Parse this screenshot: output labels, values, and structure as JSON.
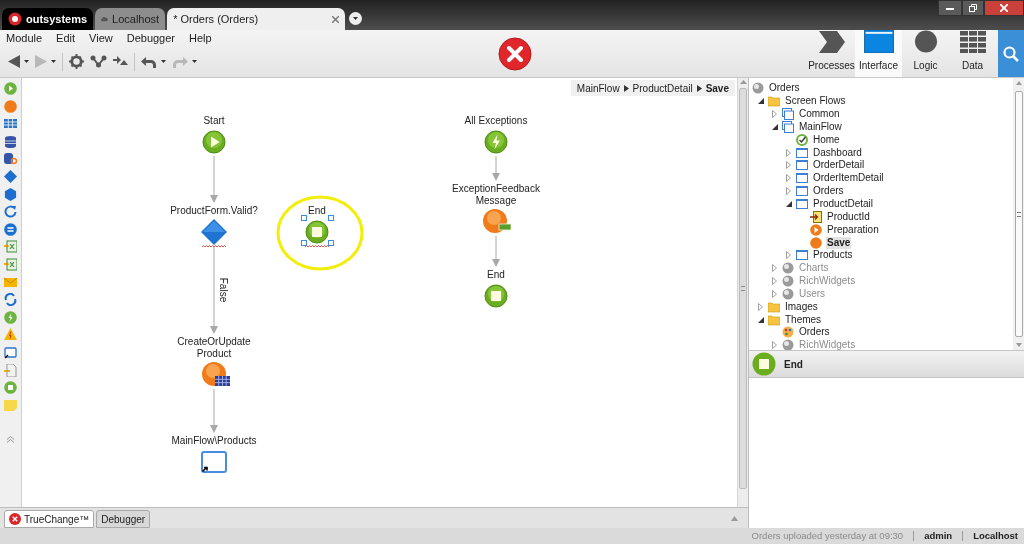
{
  "window_tabs": [
    {
      "kind": "logo",
      "label": "outsystems",
      "selected": false
    },
    {
      "kind": "server",
      "label": "Localhost",
      "selected": false
    },
    {
      "kind": "document",
      "label": "* Orders (Orders)",
      "selected": true
    }
  ],
  "menu": [
    "Module",
    "Edit",
    "View",
    "Debugger",
    "Help"
  ],
  "toolbar": [
    {
      "kind": "back",
      "disabled": false
    },
    {
      "kind": "forward",
      "disabled": true
    },
    {
      "kind": "settings",
      "disabled": false
    },
    {
      "kind": "merge",
      "disabled": false
    },
    {
      "kind": "publish",
      "disabled": false
    },
    {
      "kind": "undo",
      "disabled": false
    },
    {
      "kind": "redo",
      "disabled": true
    }
  ],
  "layers": [
    {
      "kind": "processes",
      "label": "Processes",
      "selected": false
    },
    {
      "kind": "interface",
      "label": "Interface",
      "selected": true
    },
    {
      "kind": "logic",
      "label": "Logic",
      "selected": false
    },
    {
      "kind": "data",
      "label": "Data",
      "selected": false
    }
  ],
  "breadcrumb": [
    "MainFlow",
    "ProductDetail",
    "Save"
  ],
  "flow": {
    "nodes": [
      {
        "kind": "start",
        "label": [
          "Start"
        ],
        "selected": false,
        "has_error": false,
        "highlighted": false
      },
      {
        "kind": "if",
        "label": [
          "ProductForm.Valid?"
        ],
        "selected": false,
        "has_error": true,
        "highlighted": false,
        "branch_label": "False"
      },
      {
        "kind": "end",
        "label": [
          "End"
        ],
        "selected": true,
        "has_error": true,
        "highlighted": true
      },
      {
        "kind": "action",
        "label": [
          "CreateOrUpdate",
          "Product"
        ],
        "selected": false,
        "has_error": false,
        "highlighted": false
      },
      {
        "kind": "destination",
        "label": [
          "MainFlow\\Products"
        ],
        "selected": false,
        "has_error": false,
        "highlighted": false
      },
      {
        "kind": "exception",
        "label": [
          "All Exceptions"
        ],
        "selected": false,
        "has_error": false,
        "highlighted": false
      },
      {
        "kind": "message",
        "label": [
          "ExceptionFeedback",
          "Message"
        ],
        "selected": false,
        "has_error": false,
        "highlighted": false
      },
      {
        "kind": "end",
        "label": [
          "End"
        ],
        "selected": false,
        "has_error": false,
        "highlighted": false
      }
    ]
  },
  "tree": {
    "kind": "module",
    "label": "Orders",
    "selected": false,
    "disabled": false,
    "children": [
      {
        "kind": "folder",
        "label": "Screen Flows",
        "expanded": true,
        "selected": false,
        "disabled": false,
        "children": [
          {
            "kind": "flow",
            "label": "Common",
            "expanded": false,
            "selected": false,
            "disabled": false
          },
          {
            "kind": "flow",
            "label": "MainFlow",
            "expanded": true,
            "selected": false,
            "disabled": false,
            "children": [
              {
                "kind": "home",
                "label": "Home",
                "selected": false,
                "disabled": false
              },
              {
                "kind": "screen",
                "label": "Dashboard",
                "expanded": false,
                "selected": false,
                "disabled": false
              },
              {
                "kind": "screen",
                "label": "OrderDetail",
                "expanded": false,
                "selected": false,
                "disabled": false
              },
              {
                "kind": "screen",
                "label": "OrderItemDetail",
                "expanded": false,
                "selected": false,
                "disabled": false
              },
              {
                "kind": "screen",
                "label": "Orders",
                "expanded": false,
                "selected": false,
                "disabled": false
              },
              {
                "kind": "screen",
                "label": "ProductDetail",
                "expanded": true,
                "selected": false,
                "disabled": false,
                "children": [
                  {
                    "kind": "input",
                    "label": "ProductId",
                    "selected": false,
                    "disabled": false
                  },
                  {
                    "kind": "preparation",
                    "label": "Preparation",
                    "selected": false,
                    "disabled": false
                  },
                  {
                    "kind": "action",
                    "label": "Save",
                    "selected": true,
                    "disabled": false
                  }
                ]
              },
              {
                "kind": "screen",
                "label": "Products",
                "expanded": false,
                "selected": false,
                "disabled": false
              }
            ]
          },
          {
            "kind": "module",
            "label": "Charts",
            "expanded": false,
            "selected": false,
            "disabled": true
          },
          {
            "kind": "module",
            "label": "RichWidgets",
            "expanded": false,
            "selected": false,
            "disabled": true
          },
          {
            "kind": "module",
            "label": "Users",
            "expanded": false,
            "selected": false,
            "disabled": true
          }
        ]
      },
      {
        "kind": "folder",
        "label": "Images",
        "expanded": false,
        "selected": false,
        "disabled": false
      },
      {
        "kind": "folder",
        "label": "Themes",
        "expanded": true,
        "selected": false,
        "disabled": false,
        "children": [
          {
            "kind": "theme",
            "label": "Orders",
            "selected": false,
            "disabled": false
          },
          {
            "kind": "module",
            "label": "RichWidgets",
            "expanded": false,
            "selected": false,
            "disabled": true
          }
        ]
      }
    ]
  },
  "properties": {
    "kind": "end",
    "title": "End"
  },
  "bottom_tabs": [
    {
      "kind": "truechange",
      "label": "TrueChange™",
      "selected": true
    },
    {
      "kind": "debugger",
      "label": "Debugger",
      "selected": false
    }
  ],
  "status_bar": [
    "Orders uploaded yesterday at 09:30",
    "admin",
    "Localhost"
  ]
}
